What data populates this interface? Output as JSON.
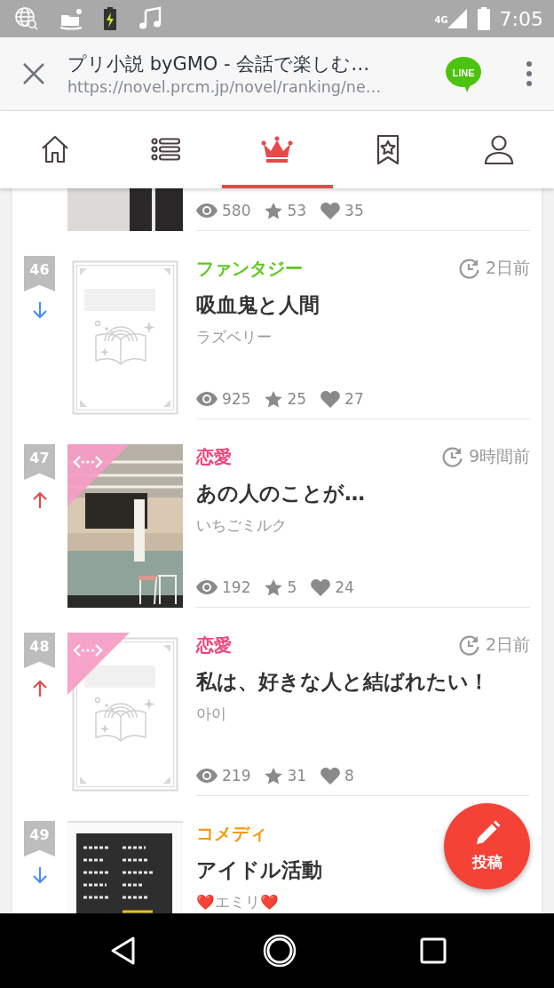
{
  "status_bar": {
    "network": "4G",
    "time": "7:05"
  },
  "browser_bar": {
    "title": "プリ小説 byGMO - 会話で楽しむ…",
    "url": "https://novel.prcm.jp/novel/ranking/ne…",
    "share_label": "LINE"
  },
  "tabs": [
    {
      "selected": false
    },
    {
      "selected": false
    },
    {
      "selected": true
    },
    {
      "selected": false
    },
    {
      "selected": false
    }
  ],
  "items": [
    {
      "kind": "partial",
      "views": "580",
      "favorites": "53",
      "likes": "35"
    },
    {
      "kind": "full",
      "rank": "46",
      "rising": false,
      "thumbnail": {
        "kind": "placeholder"
      },
      "ribbon": false,
      "genre": "ファンタジー",
      "color": "#5fc81e",
      "time": "2日前",
      "title": "吸血鬼と人間",
      "author": "ラズベリー",
      "views": "925",
      "favorites": "25",
      "likes": "27"
    },
    {
      "kind": "full",
      "rank": "47",
      "rising": true,
      "ribbon": true,
      "genre": "恋愛",
      "color": "#f0457a",
      "time": "9時間前",
      "title": "あの人のことが…",
      "author": "いちごミルク",
      "views": "192",
      "favorites": "5",
      "likes": "24"
    },
    {
      "kind": "full",
      "rank": "48",
      "rising": true,
      "thumbnail": {
        "kind": "placeholder"
      },
      "ribbon": true,
      "genre": "恋愛",
      "color": "#f0457a",
      "time": "2日前",
      "title": "私は、好きな人と結ばれたい！",
      "author": "아이",
      "views": "219",
      "favorites": "31",
      "likes": "8"
    },
    {
      "kind": "full",
      "rank": "49",
      "rising": false,
      "ribbon": false,
      "genre": "コメディ",
      "color": "#f39a12",
      "title": "アイドル活動",
      "author": "❤️エミリ❤️"
    }
  ],
  "fab": {
    "label": "投稿"
  }
}
